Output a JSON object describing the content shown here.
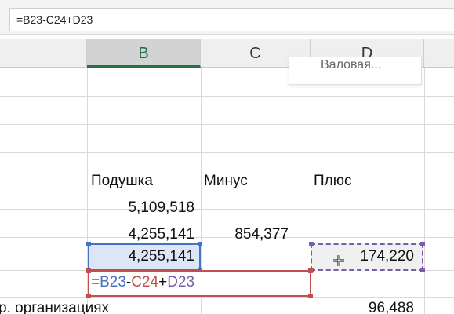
{
  "formula_bar": {
    "value": "=B23-C24+D23"
  },
  "columns": [
    {
      "id": "B",
      "label": "B",
      "selected": true
    },
    {
      "id": "C",
      "label": "C",
      "selected": false
    },
    {
      "id": "D",
      "label": "D",
      "selected": false
    }
  ],
  "chart_label": "Валовая...",
  "headers": {
    "b": "Подушка",
    "c": "Минус",
    "d": "Плюс"
  },
  "rows": [
    {
      "b": "5,109,518",
      "c": "",
      "d": ""
    },
    {
      "b": "4,255,141",
      "c": "854,377",
      "d": ""
    },
    {
      "b": "4,255,141",
      "c": "",
      "d": "174,220"
    }
  ],
  "edit_formula": {
    "eq": "=",
    "b_ref": "B23",
    "op1": "-",
    "c_ref": "C24",
    "op2": "+",
    "d_ref": "D23"
  },
  "last_row": {
    "a": "р. организациях",
    "d": "96,488"
  },
  "colors": {
    "ref_b": "#4472c4",
    "ref_c": "#c0504d",
    "ref_d": "#7a5ca8",
    "selected_header": "#217346"
  }
}
